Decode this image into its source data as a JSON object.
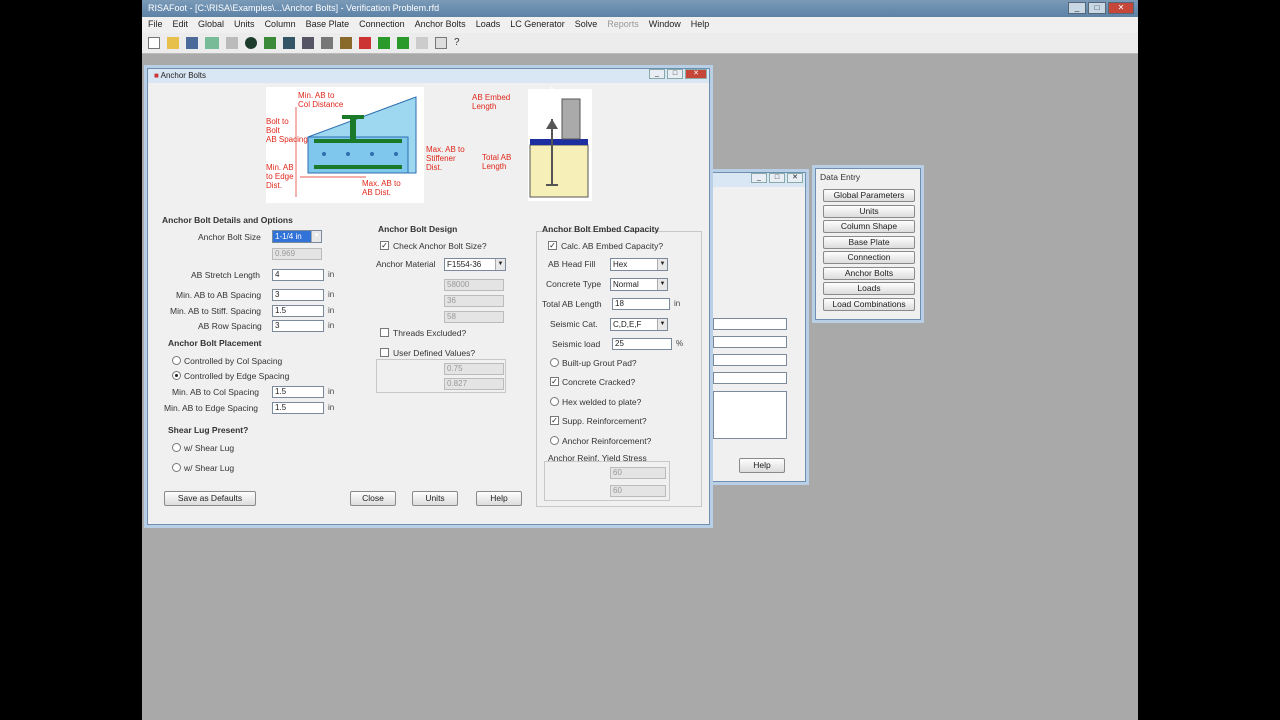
{
  "window_title": "RISAFoot - [C:\\RISA\\Examples\\...\\Anchor Bolts] - Verification Problem.rfd",
  "menu": [
    "File",
    "Edit",
    "Global",
    "Units",
    "Column",
    "Base Plate",
    "Connection",
    "Anchor Bolts",
    "Loads",
    "LC Generator",
    "Solve",
    "Reports",
    "Window",
    "Help"
  ],
  "dialog": {
    "title": "Anchor Bolts",
    "diagram1": {
      "min_bolt_to_col": "Min. AB to\nCol Distance",
      "bolt_to_bolt": "Bolt to\nBolt\nAB Spacing",
      "min_to_edge": "Min. AB\nto Edge\nDist.",
      "max_to_stiff": "Max. AB to\nStiffener\nDist.",
      "min_bolt_space": "Max. AB to\nAB Dist."
    },
    "diagram2": {
      "embed": "AB Embed\nLength",
      "total": "Total AB\nLength"
    },
    "details": {
      "heading": "Anchor Bolt Details and Options",
      "bolt_size_label": "Anchor Bolt Size",
      "bolt_size_value": "1-1/4 in",
      "bolt_size_sub": "0.969",
      "stretch_label": "AB Stretch Length",
      "stretch_value": "4",
      "ab_spacing_label": "Min. AB to AB Spacing",
      "ab_spacing_value": "3",
      "stiff_spacing_label": "Min. AB to Stiff. Spacing",
      "stiff_spacing_value": "1.5",
      "row_spacing_label": "AB Row Spacing",
      "row_spacing_value": "3",
      "unit": "in"
    },
    "placement": {
      "heading": "Anchor Bolt Placement",
      "opt1": "Controlled by Col Spacing",
      "opt2": "Controlled by Edge Spacing",
      "col_spacing_label": "Min. AB to Col Spacing",
      "col_spacing_value": "1.5",
      "edge_spacing_label": "Min. AB to Edge Spacing",
      "edge_spacing_value": "1.5",
      "unit": "in"
    },
    "shear_lug": {
      "heading": "Shear Lug Present?",
      "opt1": "w/ Shear Lug",
      "opt2": "w/ Shear Lug"
    },
    "design": {
      "heading": "Anchor Bolt Design",
      "check_label": "Check Anchor Bolt Size?",
      "material_label": "Anchor Material",
      "material_value": "F1554-36",
      "dis1": "58000",
      "dis2": "36",
      "dis3": "58",
      "threads_label": "Threads Excluded?",
      "userdef_label": "User Defined Values?",
      "dis4": "0.75",
      "dis5": "0.827"
    },
    "embed": {
      "heading": "Anchor Bolt Embed Capacity",
      "calc_label": "Calc. AB Embed Capacity?",
      "head_label": "AB Head Fill",
      "head_value": "Hex",
      "concrete_label": "Concrete Type",
      "concrete_value": "Normal",
      "embed_len_label": "Total AB Length",
      "embed_len_value": "18",
      "embed_unit": "in",
      "seismic_label": "Seismic Cat.",
      "seismic_value": "C,D,E,F",
      "seismic_load_label": "Seismic load",
      "seismic_load_value": "25",
      "seismic_unit": "%",
      "grout_label": "Built-up Grout Pad?",
      "cracked_label": "Concrete Cracked?",
      "welded_label": "Hex welded to plate?",
      "supp_label": "Supp. Reinforcement?",
      "anchor_reinf_label": "Anchor Reinforcement?",
      "yield_label": "Anchor Reinf. Yield Stress",
      "yield1": "60",
      "yield2": "60"
    },
    "buttons": {
      "save_defaults": "Save as Defaults",
      "close": "Close",
      "units": "Units",
      "help": "Help"
    }
  },
  "back_dialog": {
    "help": "Help"
  },
  "data_entry": {
    "title": "Data Entry",
    "items": [
      "Global Parameters",
      "Units",
      "Column Shape",
      "Base Plate",
      "Connection",
      "Anchor Bolts",
      "Loads",
      "Load Combinations"
    ]
  }
}
